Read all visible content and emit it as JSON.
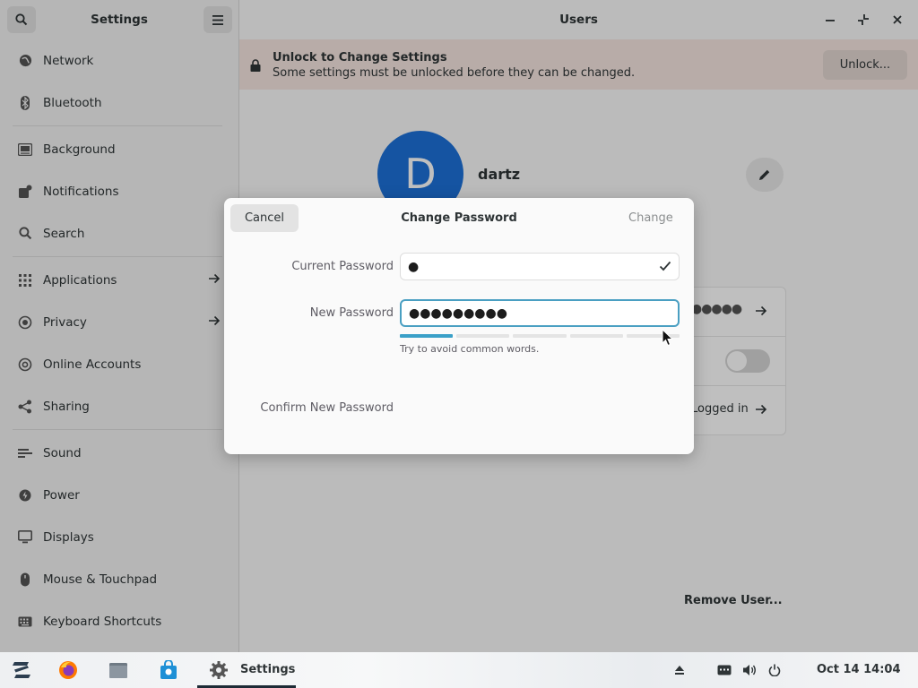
{
  "sidebar": {
    "title": "Settings",
    "items": [
      {
        "label": "Network",
        "icon": "network-icon"
      },
      {
        "label": "Bluetooth",
        "icon": "bluetooth-icon"
      },
      {
        "label": "Background",
        "icon": "background-icon"
      },
      {
        "label": "Notifications",
        "icon": "notifications-icon"
      },
      {
        "label": "Search",
        "icon": "search-icon"
      },
      {
        "label": "Applications",
        "icon": "applications-icon"
      },
      {
        "label": "Privacy",
        "icon": "privacy-icon"
      },
      {
        "label": "Online Accounts",
        "icon": "online-accounts-icon"
      },
      {
        "label": "Sharing",
        "icon": "sharing-icon"
      },
      {
        "label": "Sound",
        "icon": "sound-icon"
      },
      {
        "label": "Power",
        "icon": "power-icon"
      },
      {
        "label": "Displays",
        "icon": "displays-icon"
      },
      {
        "label": "Mouse & Touchpad",
        "icon": "mouse-icon"
      },
      {
        "label": "Keyboard Shortcuts",
        "icon": "keyboard-icon"
      }
    ]
  },
  "main": {
    "title": "Users",
    "infobar": {
      "title": "Unlock to Change Settings",
      "subtitle": "Some settings must be unlocked before they can be changed.",
      "button": "Unlock..."
    },
    "user": {
      "avatar_letter": "D",
      "name": "dartz"
    },
    "password_dots": "●●●●●",
    "logged_in_text": "Logged in",
    "remove_user": "Remove User..."
  },
  "dialog": {
    "cancel": "Cancel",
    "title": "Change Password",
    "change": "Change",
    "current_label": "Current Password",
    "current_value": "●",
    "new_label": "New Password",
    "new_value": "●●●●●●●●●",
    "strength_level": 0.2,
    "hint": "Try to avoid common words.",
    "confirm_label": "Confirm New Password"
  },
  "taskbar": {
    "active_app": "Settings",
    "clock": "Oct 14  14:04"
  },
  "colors": {
    "accent": "#3584e4",
    "avatar": "#1c71d8",
    "infobar": "#f6e6e0"
  }
}
